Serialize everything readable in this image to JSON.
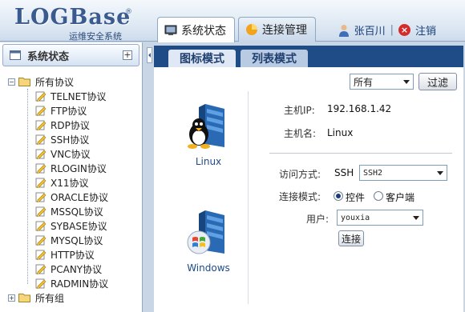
{
  "header": {
    "logo": "LOGBase",
    "logo_sub": "运维安全系统",
    "logo_reg": "®",
    "tabs": [
      {
        "label": "系统状态",
        "active": true,
        "icon": "monitor-icon"
      },
      {
        "label": "连接管理",
        "active": false,
        "icon": "pie-chart-icon"
      }
    ],
    "user_name": "张百川",
    "separator": "|",
    "logout_label": "注销"
  },
  "sidebar": {
    "title": "系统状态",
    "root_label": "所有协议",
    "protocols": [
      "TELNET协议",
      "FTP协议",
      "RDP协议",
      "SSH协议",
      "VNC协议",
      "RLOGIN协议",
      "X11协议",
      "ORACLE协议",
      "MSSQL协议",
      "SYBASE协议",
      "MYSQL协议",
      "HTTP协议",
      "PCANY协议",
      "RADMIN协议"
    ],
    "group_label": "所有组"
  },
  "main": {
    "view_tabs": [
      {
        "label": "图标模式",
        "active": true
      },
      {
        "label": "列表模式",
        "active": false
      }
    ],
    "filter": {
      "selected": "所有",
      "button": "过滤"
    },
    "hosts": [
      {
        "name": "Linux",
        "icon": "linux-server-icon"
      },
      {
        "name": "Windows",
        "icon": "windows-server-icon"
      }
    ],
    "detail": {
      "ip_label": "主机IP:",
      "ip_value": "192.168.1.42",
      "hostname_label": "主机名:",
      "hostname_value": "Linux",
      "access_label": "访问方式:",
      "access_protocol": "SSH",
      "access_selected": "SSH2",
      "mode_label": "连接模式:",
      "mode_options": [
        {
          "label": "控件",
          "checked": true
        },
        {
          "label": "客户端",
          "checked": false
        }
      ],
      "user_label": "用户:",
      "user_selected": "youxia",
      "connect_button": "连接"
    }
  },
  "colors": {
    "nav_dark": "#1f4c86",
    "link": "#1c4a8a",
    "logo": "#3a5b8f",
    "logout_red": "#d42b2b"
  }
}
